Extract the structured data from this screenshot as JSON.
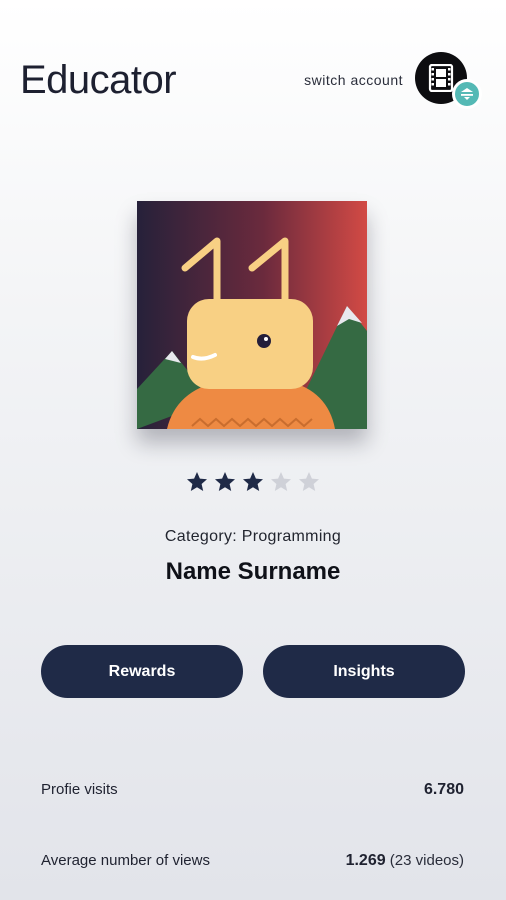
{
  "header": {
    "title": "Educator",
    "switch_account_label": "switch account",
    "avatar_icon": "film-strip-icon",
    "switch_icon": "switch-account-icon"
  },
  "profile": {
    "image_icon": "llama-character-illustration",
    "rating": 3,
    "rating_max": 5,
    "category": "Category: Programming",
    "name": "Name Surname"
  },
  "actions": {
    "rewards_label": "Rewards",
    "insights_label": "Insights"
  },
  "stats": [
    {
      "label": "Profie visits",
      "value": "6.780",
      "extra": ""
    },
    {
      "label": "Average number of views",
      "value": "1.269",
      "extra": "(23 videos)"
    }
  ],
  "colors": {
    "primary_button": "#1f2a47",
    "star_filled": "#1f2a47",
    "star_empty": "#cfd1d8",
    "badge": "#54b9b5"
  }
}
